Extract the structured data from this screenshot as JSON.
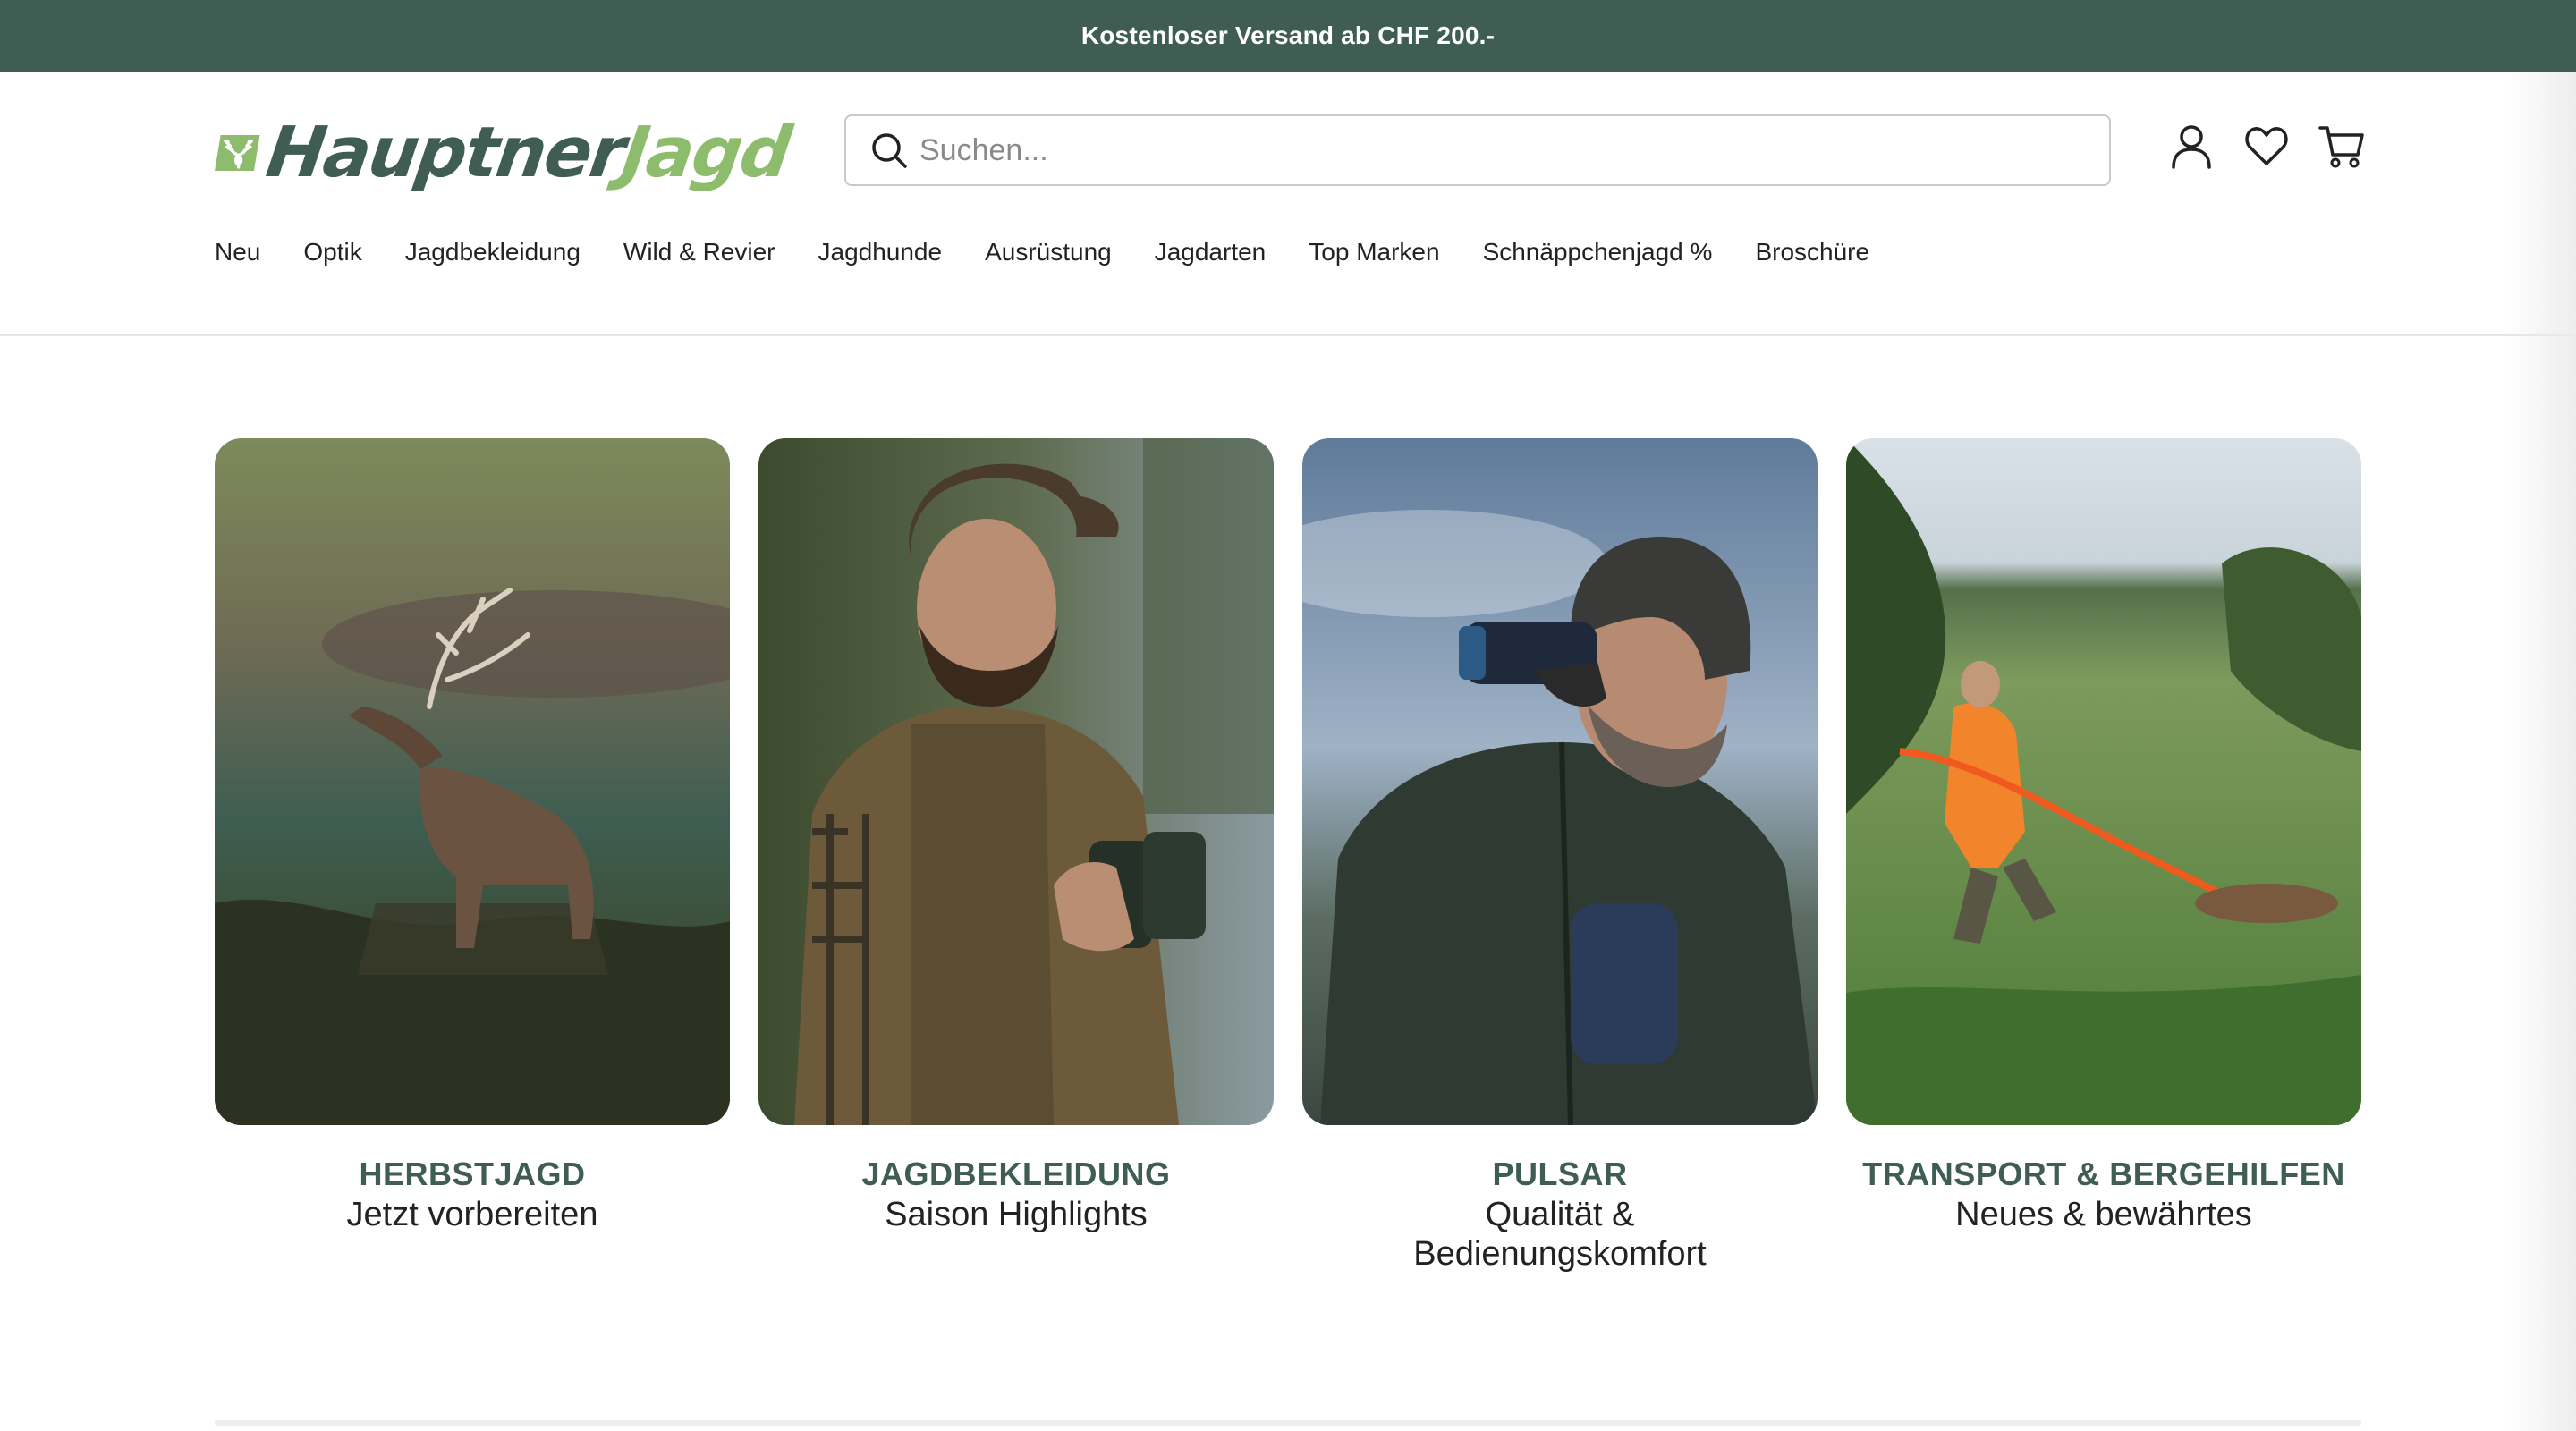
{
  "promo": {
    "text": "Kostenloser Versand ab CHF 200.-"
  },
  "brand": {
    "name_part_a": "Hauptner",
    "name_part_b": "Jagd",
    "accent": "#3f5d53",
    "accent_light": "#8dbd6c"
  },
  "search": {
    "placeholder": "Suchen...",
    "value": ""
  },
  "header_icons": [
    "user-icon",
    "heart-icon",
    "cart-icon"
  ],
  "nav": {
    "items": [
      {
        "label": "Neu"
      },
      {
        "label": "Optik"
      },
      {
        "label": "Jagdbekleidung"
      },
      {
        "label": "Wild & Revier"
      },
      {
        "label": "Jagdhunde"
      },
      {
        "label": "Ausrüstung"
      },
      {
        "label": "Jagdarten"
      },
      {
        "label": "Top Marken"
      },
      {
        "label": "Schnäppchenjagd %"
      },
      {
        "label": "Broschüre"
      }
    ]
  },
  "cards": [
    {
      "title": "HERBSTJAGD",
      "subtitle": "Jetzt vorbereiten"
    },
    {
      "title": "JAGDBEKLEIDUNG",
      "subtitle": "Saison Highlights"
    },
    {
      "title": "PULSAR",
      "subtitle": "Qualität & Bedienungskomfort"
    },
    {
      "title": "TRANSPORT & BERGEHILFEN",
      "subtitle": "Neues & bewährtes"
    }
  ]
}
